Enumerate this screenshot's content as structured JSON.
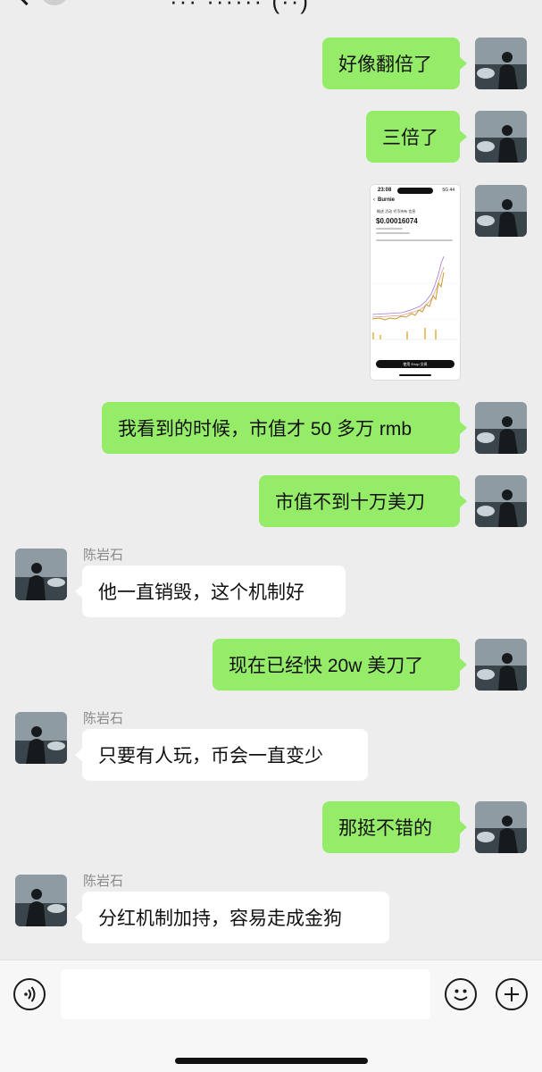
{
  "header": {
    "title": "··· ······ (··)"
  },
  "messages": [
    {
      "side": "sent",
      "text": "好像翻倍了"
    },
    {
      "side": "sent",
      "text": "三倍了"
    },
    {
      "side": "sent",
      "type": "image"
    },
    {
      "side": "sent",
      "text": "我看到的时候，市值才 50 多万 rmb"
    },
    {
      "side": "sent",
      "text": "市值不到十万美刀"
    },
    {
      "side": "recv",
      "sender": "陈岩石",
      "text": "他一直销毁，这个机制好"
    },
    {
      "side": "sent",
      "text": "现在已经快 20w 美刀了"
    },
    {
      "side": "recv",
      "sender": "陈岩石",
      "text": "只要有人玩，币会一直变少"
    },
    {
      "side": "sent",
      "text": "那挺不错的"
    },
    {
      "side": "recv",
      "sender": "陈岩石",
      "text": "分红机制加持，容易走成金狗"
    }
  ],
  "screenshot": {
    "time": "23:08",
    "status": "5G 44",
    "token_name": "Burnie",
    "tab_label": "概述  活动  代币持有  信息",
    "price": "$0.00016074",
    "button_label": "使用 Exop 交易",
    "chart": {
      "type": "line",
      "trend": "sharp rise at end"
    }
  },
  "input_bar": {
    "placeholder": "",
    "icons": [
      "voice-icon",
      "emoji-icon",
      "plus-icon"
    ]
  },
  "colors": {
    "background": "#ededed",
    "sent_bubble": "#95ec69",
    "recv_bubble": "#ffffff",
    "input_bar": "#f7f7f7"
  }
}
